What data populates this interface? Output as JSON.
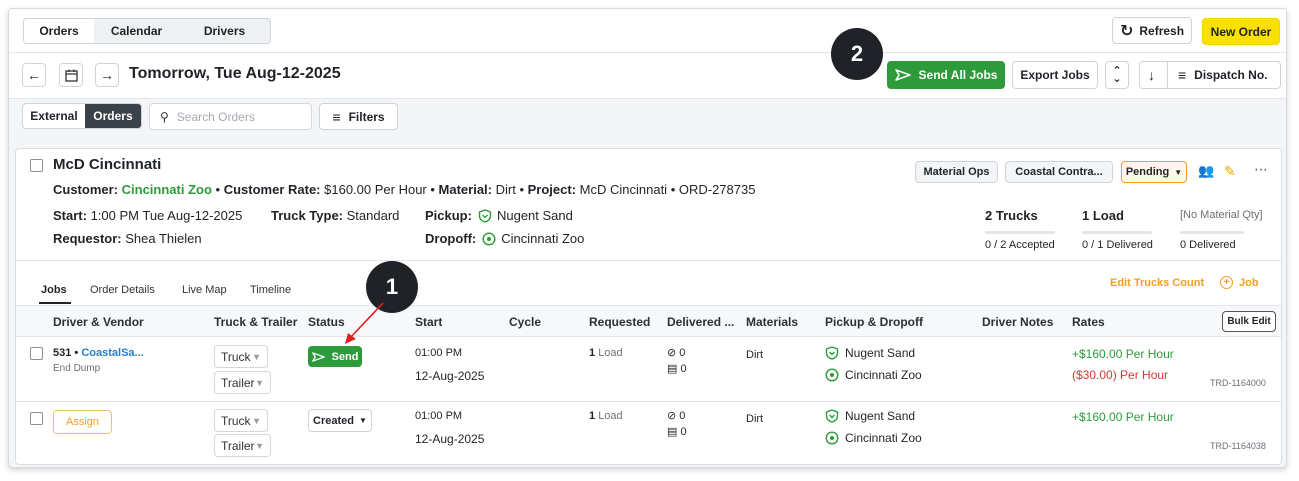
{
  "top_tabs": [
    "Orders",
    "Calendar",
    "Drivers"
  ],
  "toolbar": {
    "refresh_label": "Refresh",
    "new_order_label": "New Order",
    "date_label": "Tomorrow, Tue Aug-12-2025",
    "send_all_label": "Send All Jobs",
    "export_label": "Export Jobs",
    "dispatch_label": "Dispatch No."
  },
  "filters": {
    "seg_external": "External",
    "seg_orders": "Orders",
    "search_placeholder": "Search Orders",
    "filters_label": "Filters"
  },
  "order": {
    "title": "McD Cincinnati",
    "customer_label": "Customer:",
    "customer_value": "Cincinnati Zoo",
    "rate_label": "Customer Rate:",
    "rate_value": "$160.00 Per Hour",
    "material_label": "Material:",
    "material_value": "Dirt",
    "project_label": "Project:",
    "project_value": "McD Cincinnati",
    "order_id": "ORD-278735",
    "start_label": "Start:",
    "start_value": "1:00 PM Tue Aug-12-2025",
    "truck_type_label": "Truck Type:",
    "truck_type_value": "Standard",
    "requestor_label": "Requestor:",
    "requestor_value": "Shea Thielen",
    "pickup_label": "Pickup:",
    "pickup_value": "Nugent Sand",
    "dropoff_label": "Dropoff:",
    "dropoff_value": "Cincinnati Zoo",
    "chip_material_ops": "Material Ops",
    "chip_coastal": "Coastal Contra...",
    "status": "Pending",
    "trucks_title": "2 Trucks",
    "trucks_sub": "0 / 2 Accepted",
    "load_title": "1 Load",
    "load_sub": "0 / 1 Delivered",
    "material_qty_title": "[No Material Qty]",
    "material_qty_sub": "0 Delivered"
  },
  "subtabs": [
    "Jobs",
    "Order Details",
    "Live Map",
    "Timeline"
  ],
  "actions": {
    "edit_trucks": "Edit Trucks Count",
    "add_job": "Job",
    "bulk_edit": "Bulk Edit"
  },
  "table": {
    "headers": [
      "Driver & Vendor",
      "Truck & Trailer",
      "Status",
      "Start",
      "Cycle",
      "Requested",
      "Delivered ...",
      "Materials",
      "Pickup & Dropoff",
      "Driver Notes",
      "Rates"
    ],
    "rows": [
      {
        "driver_num": "531 •",
        "vendor": "CoastalSa...",
        "driver_sub": "End Dump",
        "truck": "Truck",
        "trailer": "Trailer",
        "status": "Send",
        "start_time": "01:00 PM",
        "start_date": "12-Aug-2025",
        "requested_num": "1",
        "requested_unit": "Load",
        "delivered_a": "0",
        "delivered_b": "0",
        "material": "Dirt",
        "pickup": "Nugent Sand",
        "dropoff": "Cincinnati Zoo",
        "rate": "+$160.00 Per Hour",
        "rate2": "($30.00) Per Hour",
        "trd": "TRD-1164000"
      },
      {
        "assign": "Assign",
        "truck": "Truck",
        "trailer": "Trailer",
        "status": "Created",
        "start_time": "01:00 PM",
        "start_date": "12-Aug-2025",
        "requested_num": "1",
        "requested_unit": "Load",
        "delivered_a": "0",
        "delivered_b": "0",
        "material": "Dirt",
        "pickup": "Nugent Sand",
        "dropoff": "Cincinnati Zoo",
        "rate": "+$160.00 Per Hour",
        "trd": "TRD-1164038"
      }
    ]
  },
  "callouts": [
    "1",
    "2"
  ],
  "colors": {
    "accent_green": "#2e9b3a",
    "new_order_yellow": "#f9e000",
    "pending_orange": "#f0a020",
    "rate_red": "#d33a2f"
  }
}
